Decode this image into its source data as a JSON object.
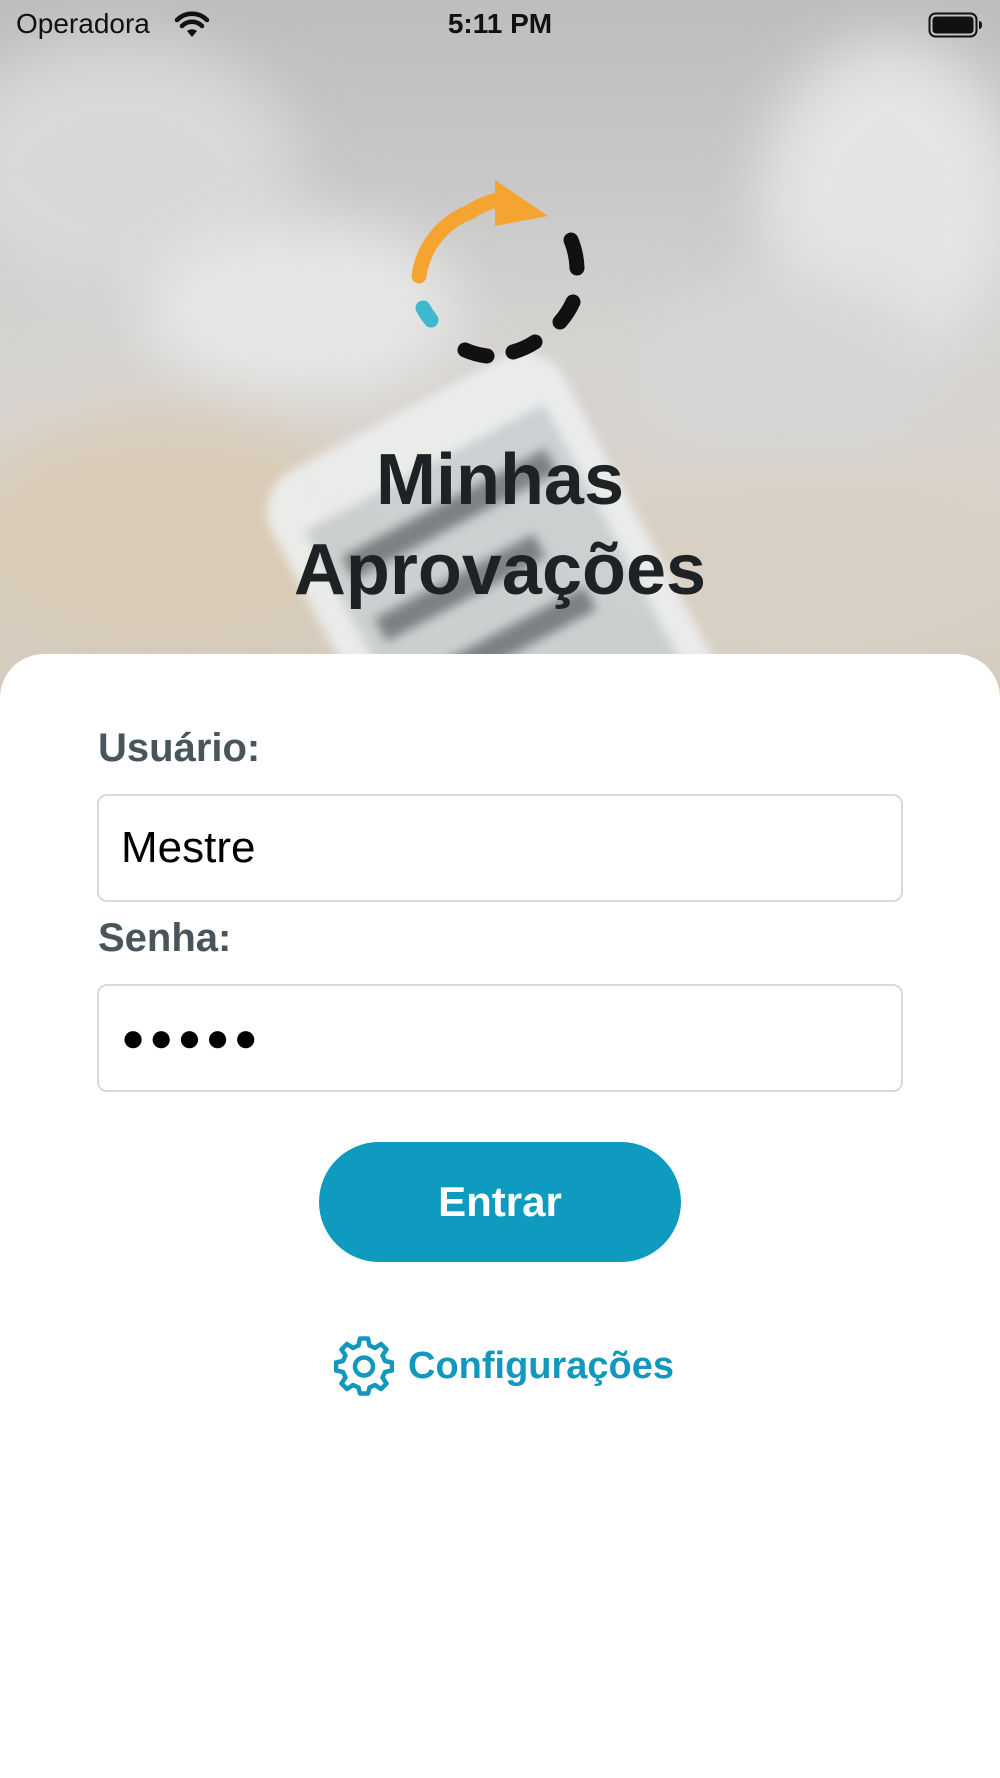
{
  "status_bar": {
    "carrier": "Operadora",
    "time": "5:11 PM",
    "wifi_icon": "wifi-icon",
    "battery_icon": "battery-full-icon"
  },
  "header": {
    "logo_icon": "sync-arrow-logo",
    "title_line1": "Minhas",
    "title_line2": "Aprovações"
  },
  "login_form": {
    "username_label": "Usuário:",
    "username_value": "Mestre",
    "password_label": "Senha:",
    "password_value": "●●●●●",
    "submit_label": "Entrar"
  },
  "settings": {
    "icon": "gear-icon",
    "label": "Configurações"
  },
  "colors": {
    "accent": "#0e9bbf",
    "link": "#1297bd",
    "label": "#48565c",
    "title": "#1f2224",
    "logo_orange": "#f5a431",
    "logo_teal": "#3db8cc"
  }
}
